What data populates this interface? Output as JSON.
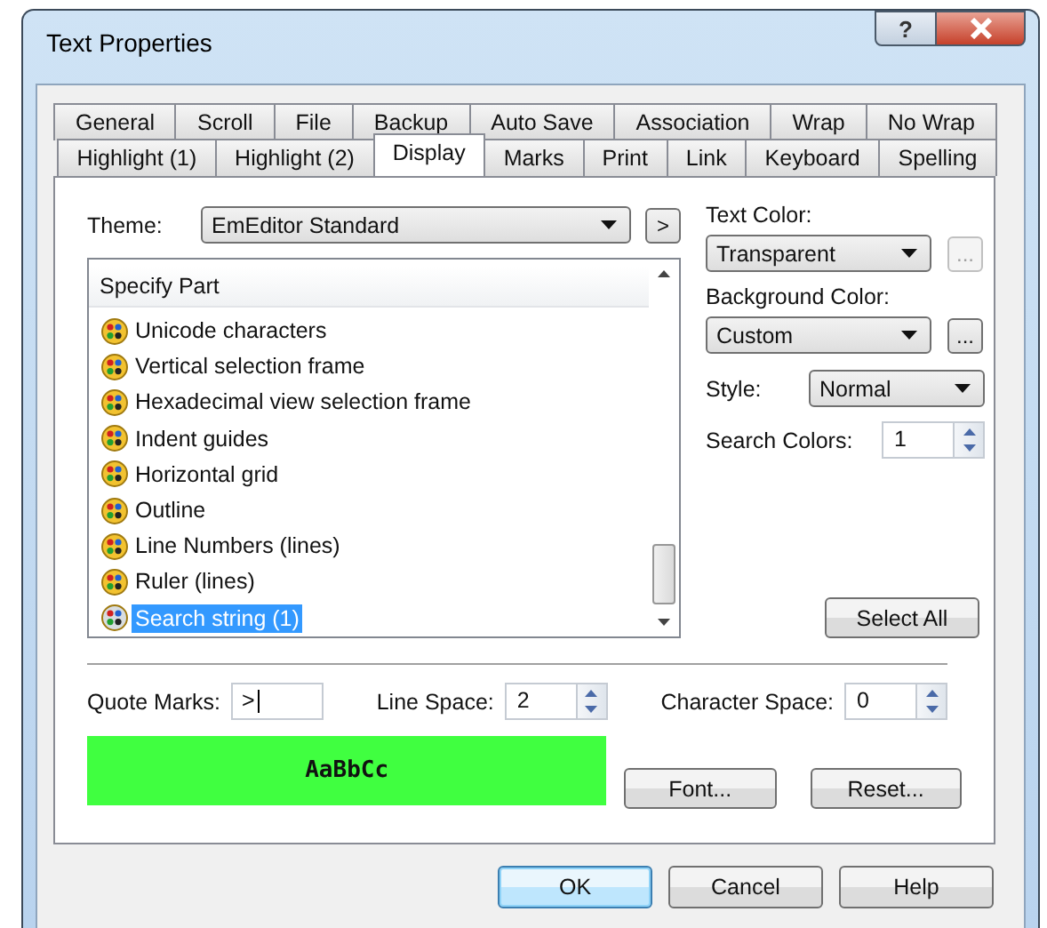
{
  "window": {
    "title": "Text Properties",
    "help_glyph": "?"
  },
  "tab_rows": [
    [
      {
        "label": "General",
        "selected": false
      },
      {
        "label": "Scroll",
        "selected": false
      },
      {
        "label": "File",
        "selected": false
      },
      {
        "label": "Backup",
        "selected": false
      },
      {
        "label": "Auto Save",
        "selected": false
      },
      {
        "label": "Association",
        "selected": false
      },
      {
        "label": "Wrap",
        "selected": false
      },
      {
        "label": "No Wrap",
        "selected": false
      }
    ],
    [
      {
        "label": "Highlight (1)",
        "selected": false
      },
      {
        "label": "Highlight (2)",
        "selected": false
      },
      {
        "label": "Display",
        "selected": true
      },
      {
        "label": "Marks",
        "selected": false
      },
      {
        "label": "Print",
        "selected": false
      },
      {
        "label": "Link",
        "selected": false
      },
      {
        "label": "Keyboard",
        "selected": false
      },
      {
        "label": "Spelling",
        "selected": false
      }
    ]
  ],
  "theme": {
    "label": "Theme:",
    "value": "EmEditor Standard",
    "next_button": ">"
  },
  "parts_list": {
    "header": "Specify Part",
    "items": [
      {
        "label": "Unicode characters",
        "selected": false
      },
      {
        "label": "Vertical selection frame",
        "selected": false
      },
      {
        "label": "Hexadecimal view selection frame",
        "selected": false
      },
      {
        "label": "Indent guides",
        "selected": false
      },
      {
        "label": "Horizontal grid",
        "selected": false
      },
      {
        "label": "Outline",
        "selected": false
      },
      {
        "label": "Line Numbers (lines)",
        "selected": false
      },
      {
        "label": "Ruler (lines)",
        "selected": false
      },
      {
        "label": "Search string (1)",
        "selected": true
      }
    ]
  },
  "text_color": {
    "label": "Text Color:",
    "value": "Transparent",
    "browse_button": "...",
    "disabled": true
  },
  "background_color": {
    "label": "Background Color:",
    "value": "Custom",
    "browse_button": "...",
    "disabled": false
  },
  "style": {
    "label": "Style:",
    "value": "Normal"
  },
  "search_colors": {
    "label": "Search Colors:",
    "value": "1"
  },
  "select_all_button": "Select All",
  "quote_marks": {
    "label": "Quote Marks:",
    "value": ">"
  },
  "line_space": {
    "label": "Line Space:",
    "value": "2"
  },
  "character_space": {
    "label": "Character Space:",
    "value": "0"
  },
  "preview": {
    "text": "AaBbCc"
  },
  "font_button": "Font...",
  "reset_button": "Reset...",
  "buttons": [
    {
      "label": "OK",
      "default": true
    },
    {
      "label": "Cancel",
      "default": false
    },
    {
      "label": "Help",
      "default": false
    }
  ]
}
